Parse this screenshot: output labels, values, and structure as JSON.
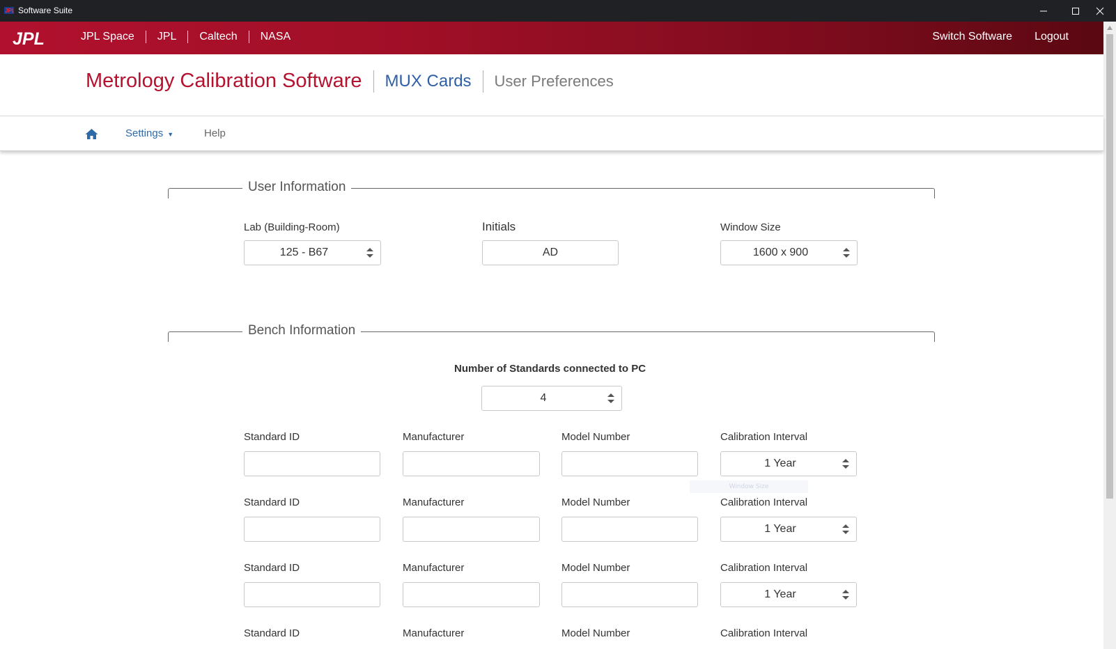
{
  "window": {
    "title": "Software Suite"
  },
  "header": {
    "logo_text": "JPL",
    "links": [
      "JPL Space",
      "JPL",
      "Caltech",
      "NASA"
    ],
    "switch_label": "Switch Software",
    "logout_label": "Logout"
  },
  "page": {
    "title": "Metrology Calibration Software",
    "section": "MUX Cards",
    "subsection": "User Preferences"
  },
  "nav": {
    "settings_label": "Settings",
    "help_label": "Help"
  },
  "user_info": {
    "legend": "User Information",
    "lab_label": "Lab (Building-Room)",
    "lab_value": "125 - B67",
    "initials_label": "Initials",
    "initials_value": "AD",
    "window_size_label": "Window Size",
    "window_size_value": "1600 x 900"
  },
  "bench_info": {
    "legend": "Bench Information",
    "num_standards_label": "Number of Standards connected to PC",
    "num_standards_value": "4",
    "rows": [
      {
        "standard_id_label": "Standard ID",
        "standard_id_value": "",
        "manufacturer_label": "Manufacturer",
        "manufacturer_value": "",
        "model_label": "Model Number",
        "model_value": "",
        "interval_label": "Calibration Interval",
        "interval_value": "1 Year"
      },
      {
        "standard_id_label": "Standard ID",
        "standard_id_value": "",
        "manufacturer_label": "Manufacturer",
        "manufacturer_value": "",
        "model_label": "Model Number",
        "model_value": "",
        "interval_label": "Calibration Interval",
        "interval_value": "1 Year"
      },
      {
        "standard_id_label": "Standard ID",
        "standard_id_value": "",
        "manufacturer_label": "Manufacturer",
        "manufacturer_value": "",
        "model_label": "Model Number",
        "model_value": "",
        "interval_label": "Calibration Interval",
        "interval_value": "1 Year"
      },
      {
        "standard_id_label": "Standard ID",
        "standard_id_value": "",
        "manufacturer_label": "Manufacturer",
        "manufacturer_value": "",
        "model_label": "Model Number",
        "model_value": "",
        "interval_label": "Calibration Interval",
        "interval_value": ""
      }
    ]
  },
  "tooltip_ghost": "Window Size",
  "colors": {
    "brand_red": "#b5122f",
    "link_blue": "#2f5fa7",
    "titlebar": "#202124"
  },
  "icons": [
    "jpl-logo",
    "home-icon",
    "caret-down-icon",
    "spinner-arrows-icon",
    "minimize-icon",
    "maximize-icon",
    "close-icon",
    "scroll-up-icon"
  ]
}
